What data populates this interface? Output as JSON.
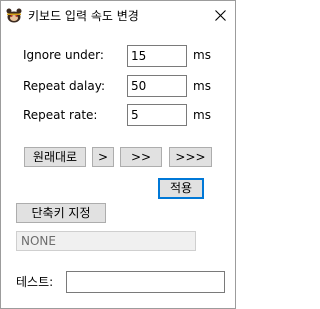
{
  "window": {
    "title": "키보드 입력 속도 변경",
    "close_glyph": "✕"
  },
  "settings": {
    "ignore_under": {
      "label": "Ignore under:",
      "value": "15",
      "unit": "ms"
    },
    "repeat_delay": {
      "label": "Repeat dalay:",
      "value": "50",
      "unit": "ms"
    },
    "repeat_rate": {
      "label": "Repeat rate:",
      "value": "5",
      "unit": "ms"
    }
  },
  "speed_buttons": {
    "reset": "원래대로",
    "fast1": ">",
    "fast2": ">>",
    "fast3": ">>>"
  },
  "apply_label": "적용",
  "hotkey": {
    "button_label": "단축키 지정",
    "current_value": "NONE"
  },
  "test": {
    "label": "테스트:",
    "value": ""
  },
  "colors": {
    "button_face": "#e1e1e1",
    "focus_border": "#0078d7",
    "readonly_bg": "#f0f0f0"
  }
}
